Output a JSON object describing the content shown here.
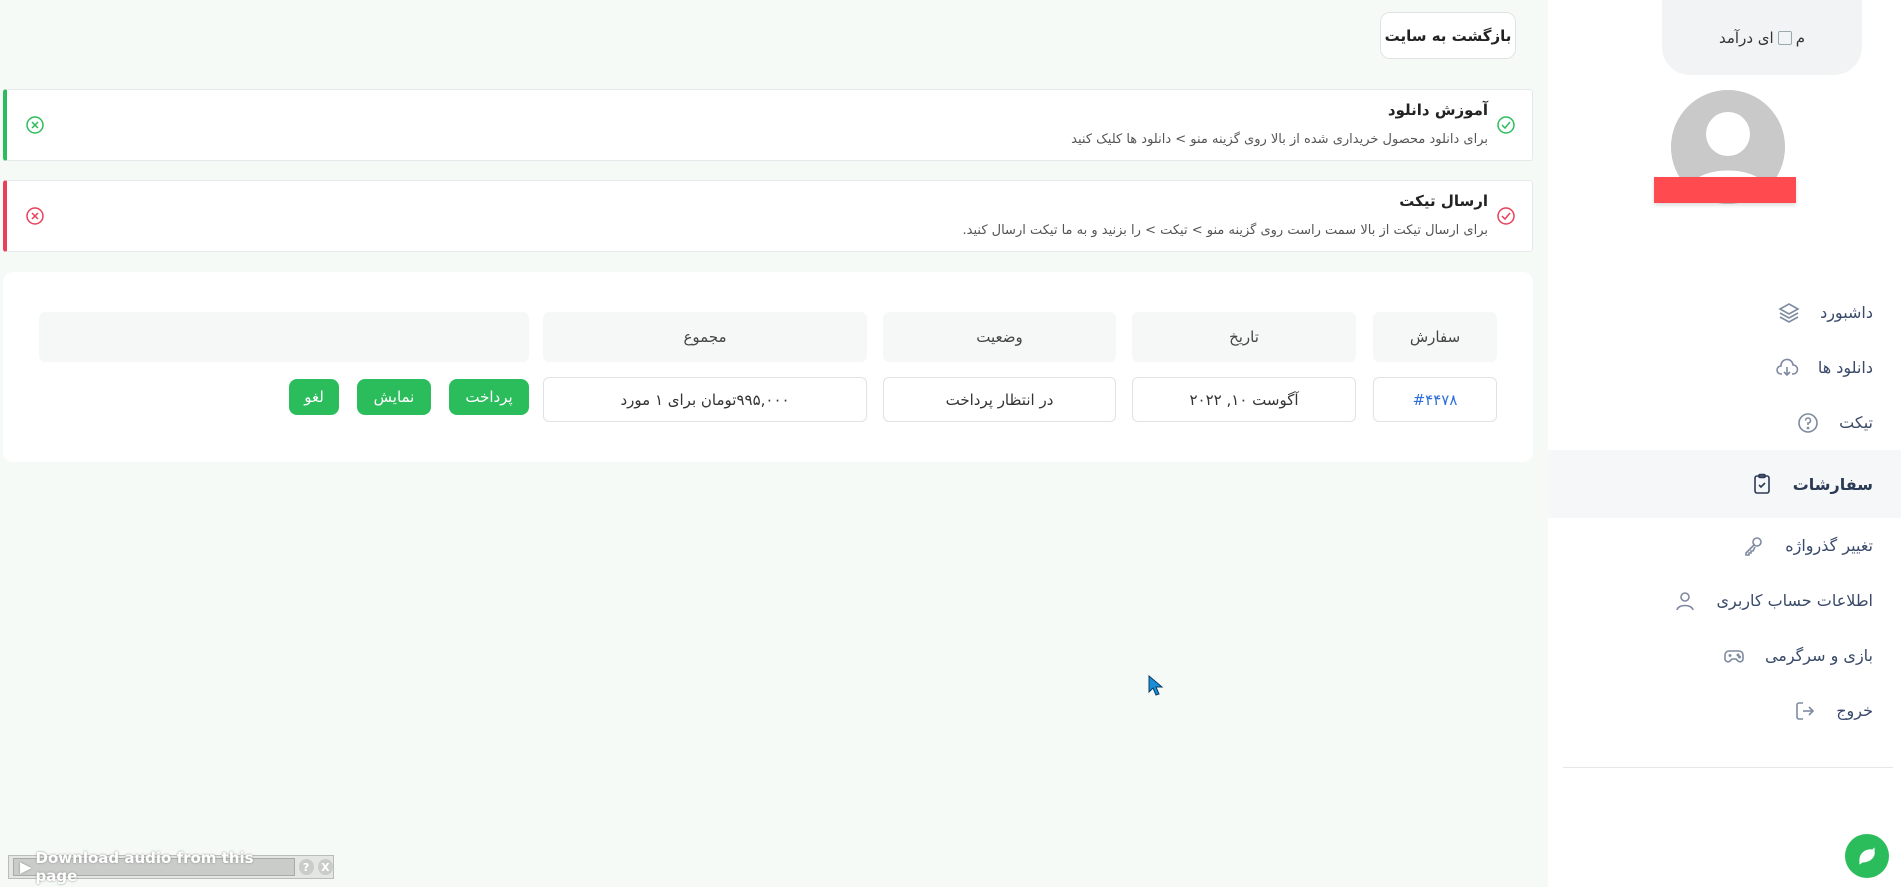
{
  "sidebar": {
    "logo_alt": "ای درآمد",
    "logo_prefix": "م",
    "menu": [
      {
        "label": "داشبورد",
        "icon": "layers-icon"
      },
      {
        "label": "دانلود ها",
        "icon": "cloud-download-icon"
      },
      {
        "label": "تیکت",
        "icon": "help-circle-icon"
      },
      {
        "label": "سفارشات",
        "icon": "clipboard-check-icon",
        "active": true
      },
      {
        "label": "تغییر گذرواژه",
        "icon": "key-icon"
      },
      {
        "label": "اطلاعات حساب کاربری",
        "icon": "user-icon"
      },
      {
        "label": "بازی و سرگرمی",
        "icon": "gamepad-icon"
      },
      {
        "label": "خروج",
        "icon": "logout-icon"
      }
    ]
  },
  "header": {
    "back_label": "بازگشت به سایت"
  },
  "notices": [
    {
      "title": "آموزش دانلود",
      "desc": "برای دانلود محصول خریداری شده از بالا روی گزینه منو > دانلود ها کلیک کنید",
      "color": "#2bbd5c"
    },
    {
      "title": "ارسال تیکت",
      "desc": "برای ارسال تیکت از بالا سمت راست روی گزینه منو > تیکت > را بزنید و به ما تیکت ارسال کنید.",
      "color": "#e8405a"
    }
  ],
  "orders": {
    "headers": {
      "order": "سفارش",
      "date": "تاریخ",
      "status": "وضعیت",
      "total": "مجموع"
    },
    "rows": [
      {
        "order": "#۴۴۷۸",
        "date": "آگوست ۱۰, ۲۰۲۲",
        "status": "در انتظار پرداخت",
        "total": "۹۹۵,۰۰۰تومان برای ۱ مورد",
        "actions": {
          "pay": "پرداخت",
          "view": "نمایش",
          "cancel": "لغو"
        }
      }
    ]
  },
  "audio_bar": {
    "label": "Download audio from this page",
    "help": "?",
    "close": "X"
  },
  "colors": {
    "accent": "#2bbd5c",
    "danger": "#e8405a",
    "name_bar": "#ff4a4f",
    "link": "#2f6fdb"
  }
}
